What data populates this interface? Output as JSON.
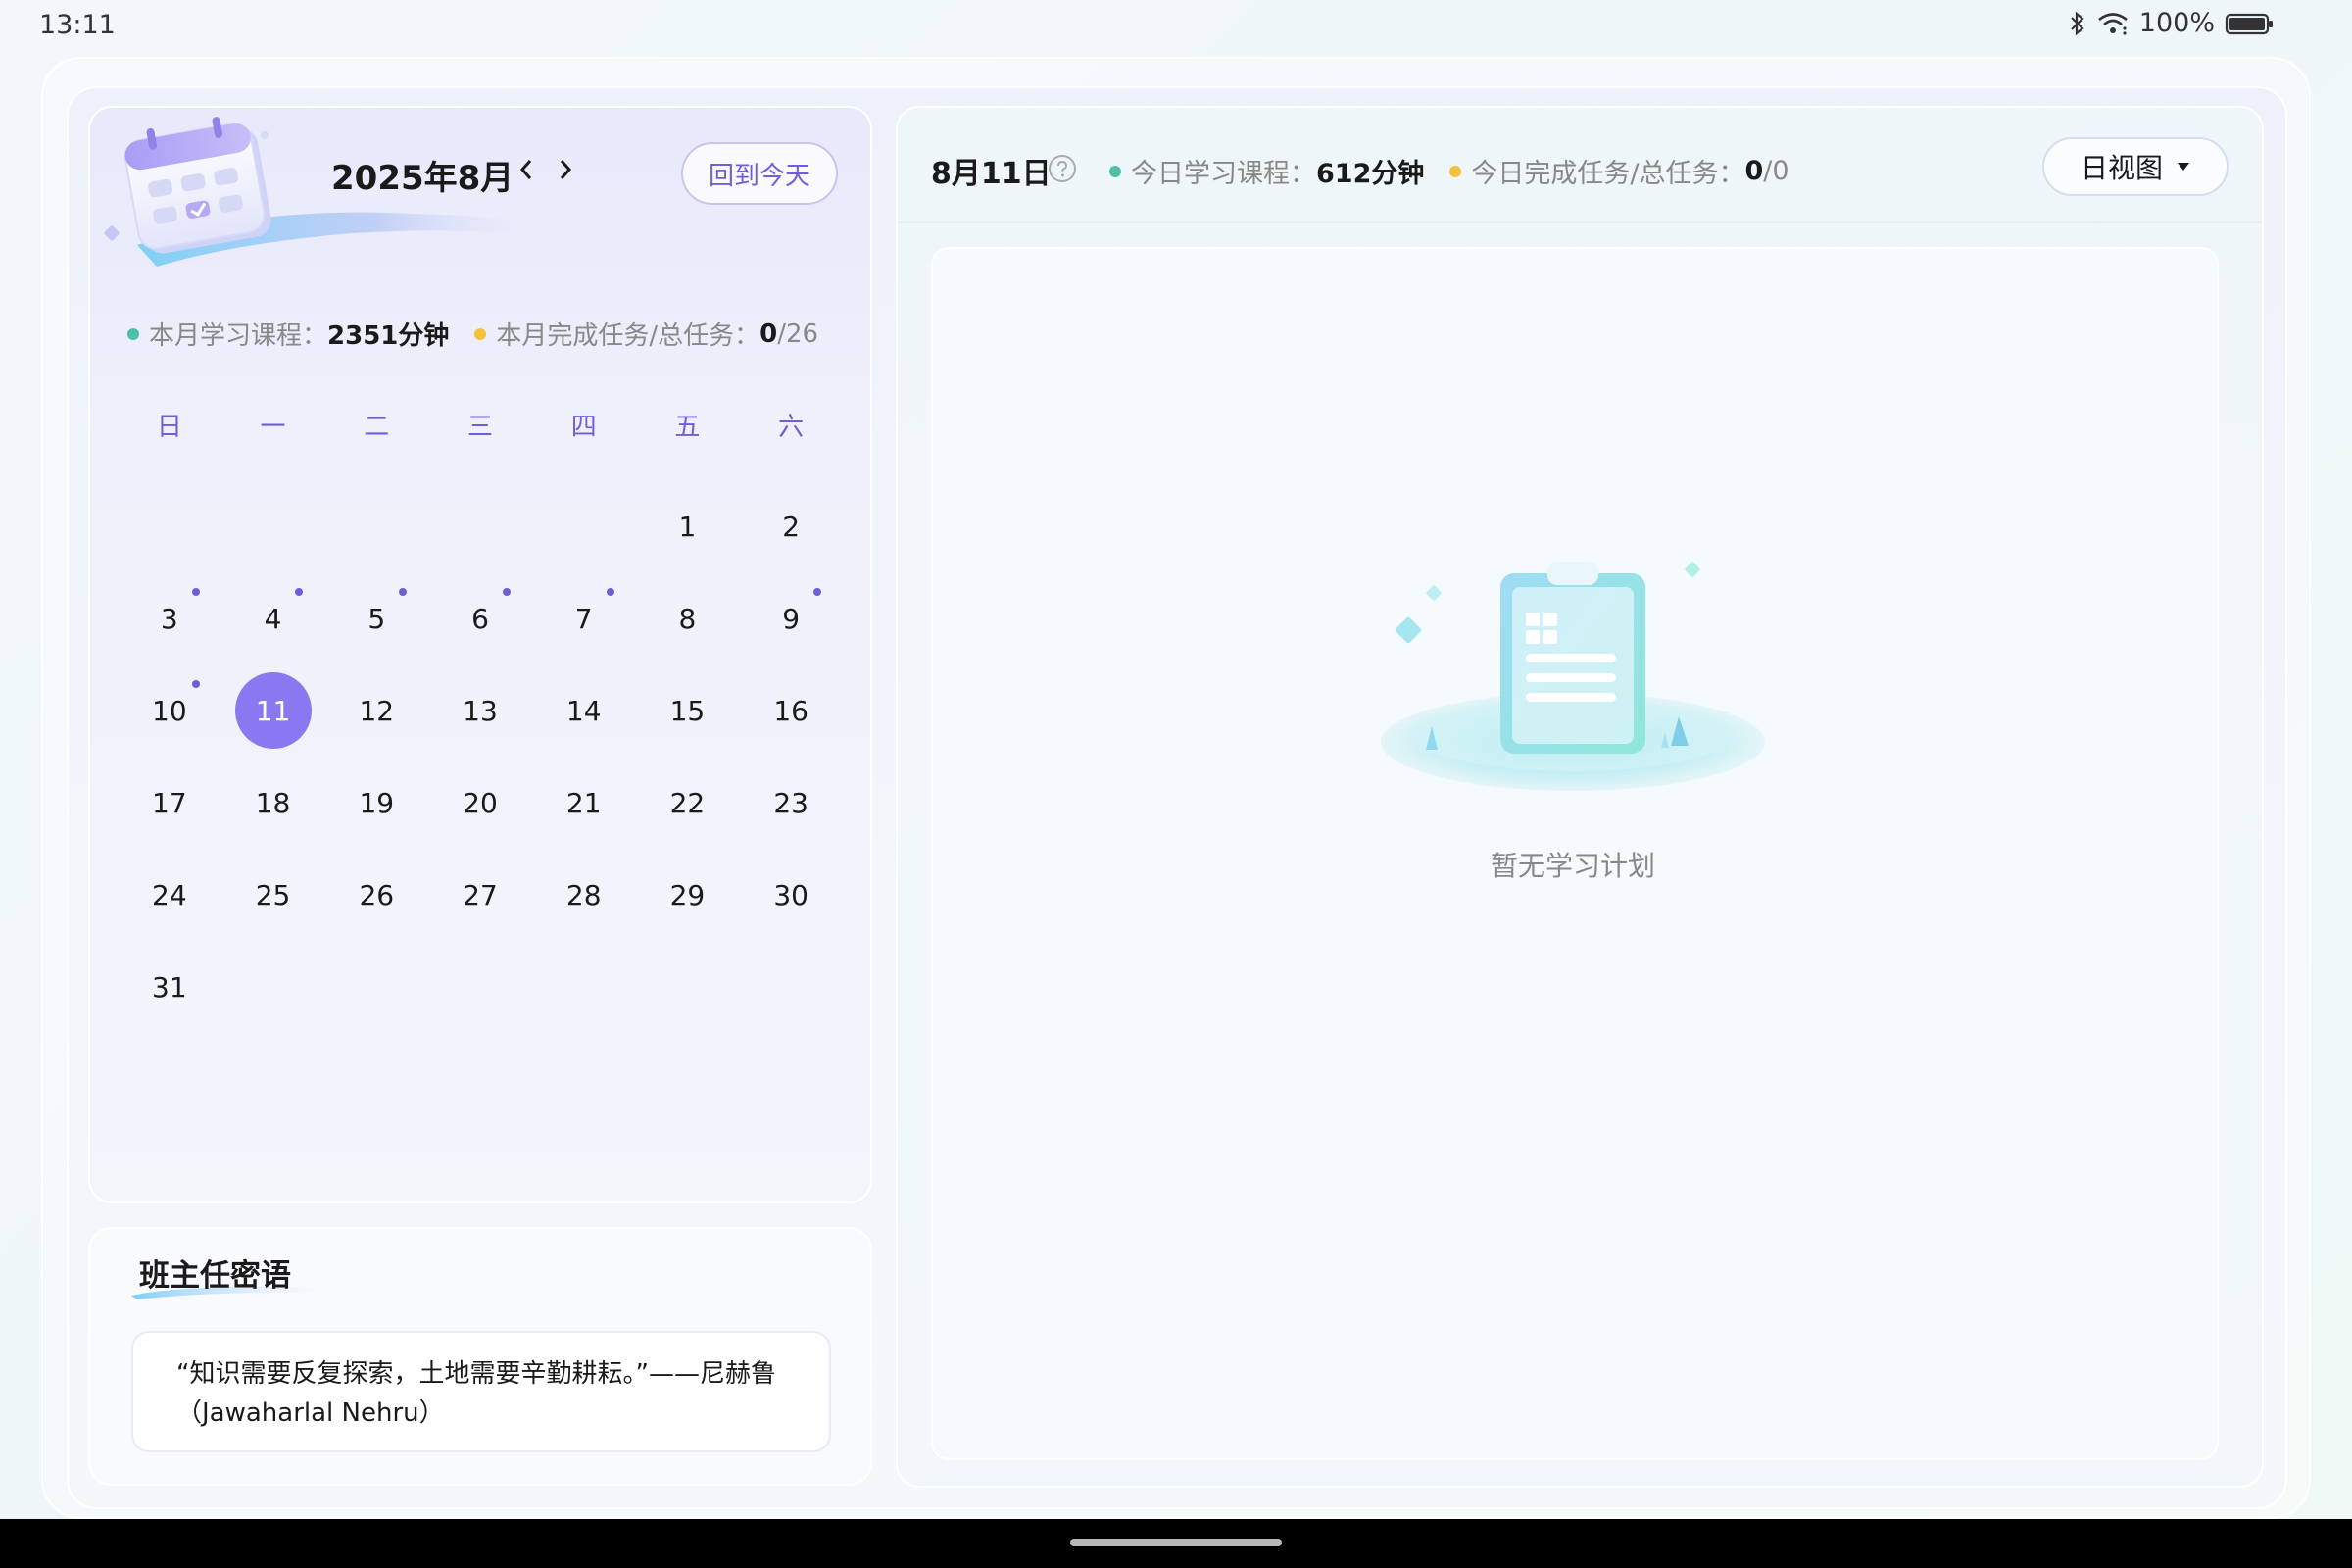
{
  "status_bar": {
    "time": "13:11",
    "battery": "100%",
    "icons": [
      "bluetooth-icon",
      "wifi-icon",
      "battery-icon"
    ]
  },
  "calendar": {
    "month_title": "2025年8月",
    "today_button": "回到今天",
    "month_stats": {
      "course_label": "本月学习课程：",
      "course_value": "2351分钟",
      "task_label": "本月完成任务/总任务：",
      "task_done": "0",
      "task_total": "/26"
    },
    "weekdays": [
      "日",
      "一",
      "二",
      "三",
      "四",
      "五",
      "六"
    ],
    "leading_blanks": 5,
    "days": [
      {
        "d": "1",
        "mark": false
      },
      {
        "d": "2",
        "mark": false
      },
      {
        "d": "3",
        "mark": true
      },
      {
        "d": "4",
        "mark": true
      },
      {
        "d": "5",
        "mark": true
      },
      {
        "d": "6",
        "mark": true
      },
      {
        "d": "7",
        "mark": true
      },
      {
        "d": "8",
        "mark": false
      },
      {
        "d": "9",
        "mark": true
      },
      {
        "d": "10",
        "mark": true
      },
      {
        "d": "11",
        "mark": false,
        "selected": true
      },
      {
        "d": "12",
        "mark": false
      },
      {
        "d": "13",
        "mark": false
      },
      {
        "d": "14",
        "mark": false
      },
      {
        "d": "15",
        "mark": false
      },
      {
        "d": "16",
        "mark": false
      },
      {
        "d": "17",
        "mark": false
      },
      {
        "d": "18",
        "mark": false
      },
      {
        "d": "19",
        "mark": false
      },
      {
        "d": "20",
        "mark": false
      },
      {
        "d": "21",
        "mark": false
      },
      {
        "d": "22",
        "mark": false
      },
      {
        "d": "23",
        "mark": false
      },
      {
        "d": "24",
        "mark": false
      },
      {
        "d": "25",
        "mark": false
      },
      {
        "d": "26",
        "mark": false
      },
      {
        "d": "27",
        "mark": false
      },
      {
        "d": "28",
        "mark": false
      },
      {
        "d": "29",
        "mark": false
      },
      {
        "d": "30",
        "mark": false
      },
      {
        "d": "31",
        "mark": false
      }
    ]
  },
  "quote": {
    "title": "班主任密语",
    "text": "“知识需要反复探索，土地需要辛勤耕耘。”——尼赫鲁（Jawaharlal Nehru）"
  },
  "day_view": {
    "date_title": "8月11日",
    "course_label": "今日学习课程：",
    "course_value": "612分钟",
    "task_label": "今日完成任务/总任务：",
    "task_done": "0",
    "task_total": "/0",
    "view_select": "日视图",
    "empty_text": "暂无学习计划"
  },
  "colors": {
    "accent": "#8a78f0",
    "accent_text": "#6e5fd6",
    "course_dot": "#4fbfa8",
    "task_dot": "#f5c13a"
  }
}
